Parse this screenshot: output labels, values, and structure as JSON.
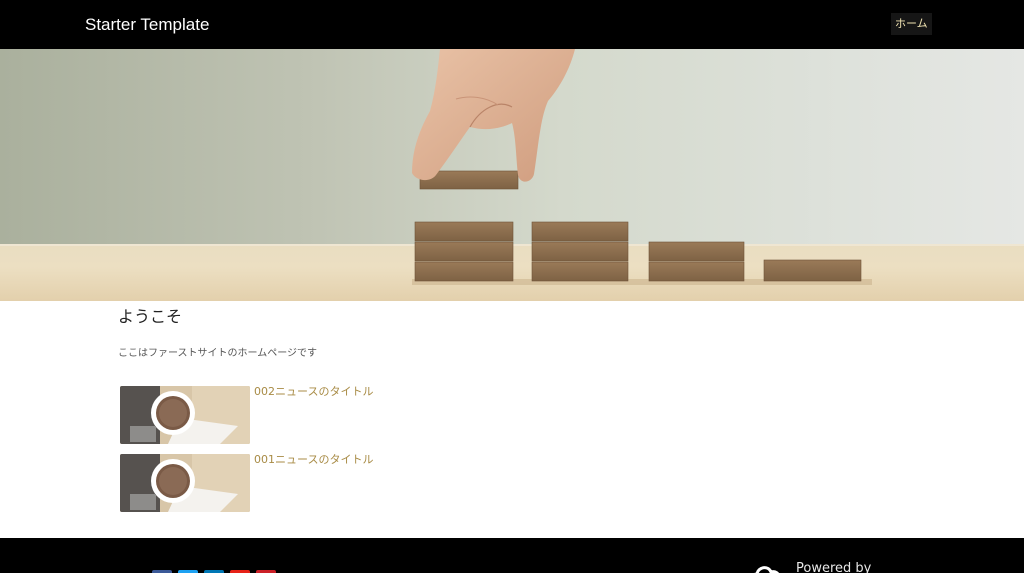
{
  "header": {
    "brand": "Starter Template",
    "nav": [
      {
        "label": "ホーム",
        "active": true
      }
    ]
  },
  "hero": {
    "image": "hand-placing-wooden-blocks-steps"
  },
  "main": {
    "title": "ようこそ",
    "intro": "ここはファーストサイトのホームページです",
    "news": [
      {
        "title": "002ニュースのタイトル",
        "thumbnail": "coffee-cup-thumbnail"
      },
      {
        "title": "001ニュースのタイトル",
        "thumbnail": "coffee-cup-thumbnail"
      }
    ]
  },
  "footer": {
    "social_icons": [
      "facebook-icon",
      "twitter-icon",
      "linkedin-icon",
      "youtube-icon",
      "pinterest-icon"
    ],
    "powered_by": "Powered by"
  },
  "colors": {
    "header_bg": "#000000",
    "nav_accent": "#f1e4b2",
    "link": "#a88b45",
    "footer_bg": "#000000"
  }
}
